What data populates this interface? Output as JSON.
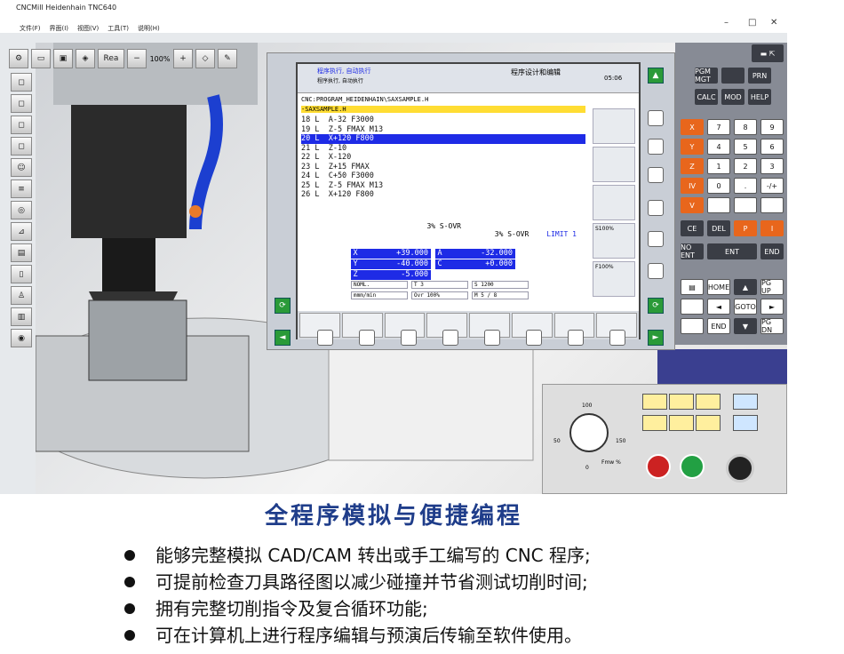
{
  "window": {
    "title": "CNCMill Heidenhain TNC640",
    "menu": [
      "文件(F)",
      "界面(I)",
      "视图(V)",
      "工具(T)",
      "说明(H)"
    ]
  },
  "toolbar": {
    "mode_label": "Rea",
    "speed_value": "100%"
  },
  "cnc": {
    "header_left_title": "程序执行, 自动执行",
    "header_left_sub": "程序执行, 自动执行",
    "header_mid": "程序设计和编辑",
    "time": "05:06",
    "path": "CNC:PROGRAM_HEIDENHAIN\\SAXSAMPLE.H",
    "file": "-SAXSAMPLE.H",
    "program_lines": [
      "18 L  A-32 F3000",
      "19 L  Z-5 FMAX M13",
      "20 L  X+120 F800",
      "21 L  Z-10",
      "22 L  X-120",
      "23 L  Z+15 FMAX",
      "24 L  C+50 F3000",
      "25 L  Z-5 FMAX M13",
      "26 L  X+120 F800"
    ],
    "selected_line_index": 2,
    "ovr1": "3%  S-OVR",
    "ovr2": "3%  S-OVR",
    "limit": "LIMIT 1",
    "axes": [
      {
        "l": "X",
        "v": "+39.000",
        "l2": "A",
        "v2": "-32.000"
      },
      {
        "l": "Y",
        "v": "-40.000",
        "l2": "C",
        "v2": "+0.000"
      },
      {
        "l": "Z",
        "v": "-5.000",
        "l2": "",
        "v2": ""
      }
    ],
    "status": {
      "mode": "NOML.",
      "t": "T 3",
      "s": "S 1200",
      "feed": "mmm/min",
      "ovr": "Ovr 100%",
      "m": "M 5 / 8"
    },
    "side": [
      "",
      "",
      "",
      "S100%",
      "F100%"
    ]
  },
  "keypad": {
    "pgm": "PGM MGT",
    "prn": "PRN",
    "calc": "CALC",
    "mod": "MOD",
    "help": "HELP",
    "ent": "ENT",
    "ce": "CE",
    "home": "HOME",
    "end": "END",
    "pgup": "PG UP",
    "pgdn": "PG DN",
    "goto": "GOTO",
    "noent": "NO ENT",
    "endk": "END",
    "letters": [
      "X",
      "Y",
      "Z",
      "IV",
      "V"
    ],
    "digits": [
      "7",
      "8",
      "9",
      "4",
      "5",
      "6",
      "1",
      "2",
      "3",
      "0",
      ".",
      "-/+"
    ],
    "letter_p": "P",
    "letter_i": "I"
  },
  "machine_panel": {
    "dial_max": "100",
    "dial_left": "50",
    "dial_right": "150",
    "dial_min": "0",
    "dial_label": "Fmw %"
  },
  "footer": {
    "title": "全程序模拟与便捷编程",
    "bullets": [
      "能够完整模拟 CAD/CAM 转出或手工编写的 CNC 程序;",
      "可提前检查刀具路径图以减少碰撞并节省测试切削时间;",
      "拥有完整切削指令及复合循环功能;",
      "可在计算机上进行程序编辑与预演后传输至软件使用。"
    ]
  }
}
